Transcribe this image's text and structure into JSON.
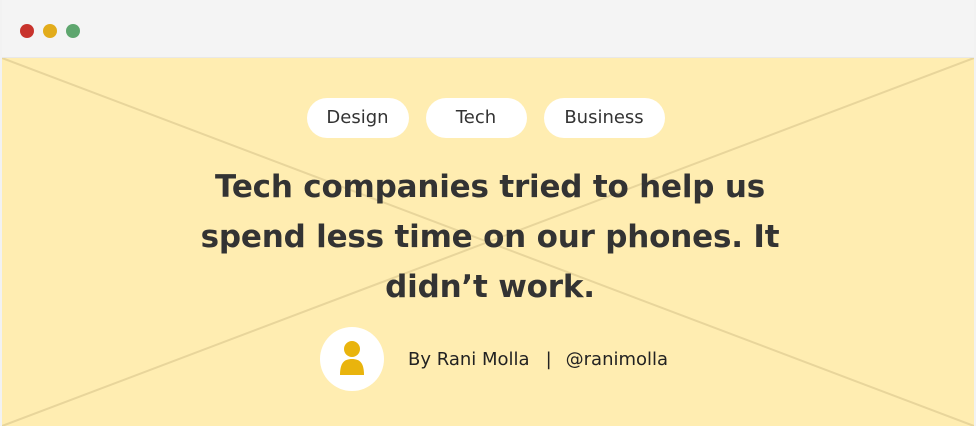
{
  "theme": {
    "window_controls": [
      "#c8332c",
      "#e2ac1b",
      "#5ea66e"
    ],
    "hero_background": "#ffedb1",
    "hero_lines": "#e8d59b",
    "avatar_icon": "#e9b40d"
  },
  "window": {
    "controls": [
      {
        "name": "close",
        "color": "#c8332c"
      },
      {
        "name": "minimize",
        "color": "#e2ac1b"
      },
      {
        "name": "maximize",
        "color": "#5ea66e"
      }
    ]
  },
  "article": {
    "tags": [
      "Design",
      "Tech",
      "Business"
    ],
    "title": "Tech companies tried to help us spend less time on our phones. It didn’t work.",
    "author": {
      "byline": "By Rani Molla",
      "separator": "|",
      "handle": "@ranimolla",
      "avatar_icon": "user-icon"
    }
  }
}
